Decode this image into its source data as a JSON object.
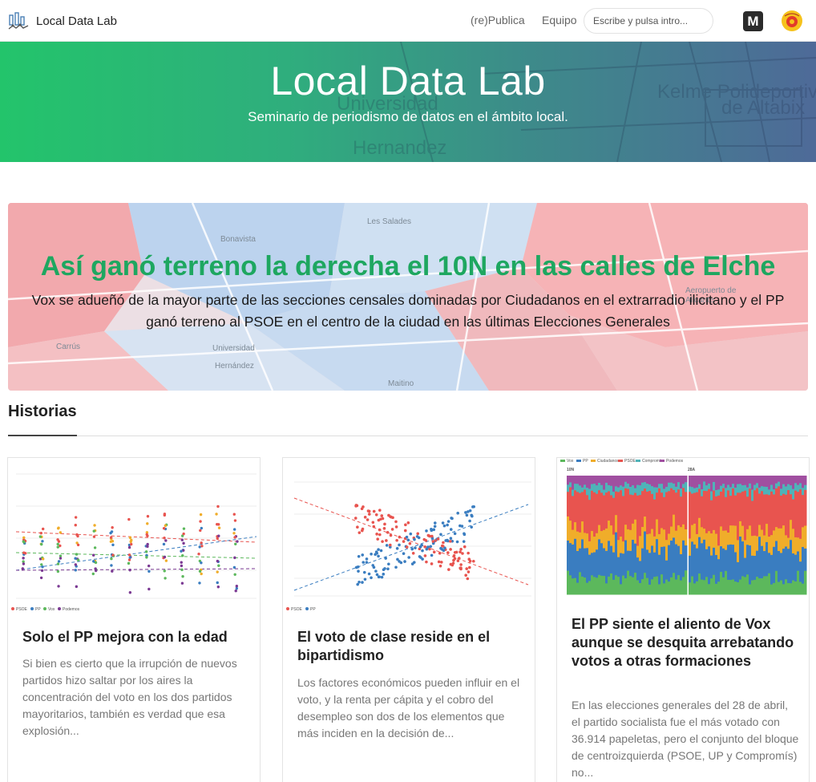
{
  "nav": {
    "brand": "Local Data Lab",
    "links": [
      "(re)Publica",
      "Equipo"
    ],
    "search_placeholder": "Escribe y pulsa intro...",
    "m_icon": "M"
  },
  "hero": {
    "title": "Local Data Lab",
    "subtitle": "Seminario de periodismo de datos en el ámbito local."
  },
  "feature": {
    "title": "Así ganó terreno la derecha el 10N en las calles de Elche",
    "text": "Vox se adueñó de la mayor parte de las secciones censales dominadas por Ciudadanos en el extrarradio ilicitano y el PP ganó terreno al PSOE en el centro de la ciudad en las últimas Elecciones Generales"
  },
  "section": {
    "title": "Historias"
  },
  "cards": [
    {
      "title": "Solo el PP mejora con la edad",
      "text": "Si bien es cierto que la irrupción de nuevos partidos hizo saltar por los aires la concentración del voto en los dos partidos mayoritarios, también es verdad que esa explosión..."
    },
    {
      "title": "El voto de clase reside en el bipartidismo",
      "text": "Los factores económicos pueden influir en el voto, y la renta per cápita y el cobro del desempleo son dos de los elementos que más inciden en la decisión de..."
    },
    {
      "title": "El PP siente el aliento de Vox aunque se desquita arrebatando votos a otras formaciones",
      "text": "En las elecciones generales del 28 de abril, el partido socialista fue el más votado con 36.914 papeletas, pero el conjunto del bloque de centroizquierda (PSOE, UP y Compromís) no..."
    }
  ],
  "colors": {
    "accent_green": "#1ea760",
    "psoe": "#e8544f",
    "pp": "#3a7dc0",
    "vox": "#5cb85c",
    "cs": "#f0ad2a",
    "podemos": "#7b3a93"
  }
}
